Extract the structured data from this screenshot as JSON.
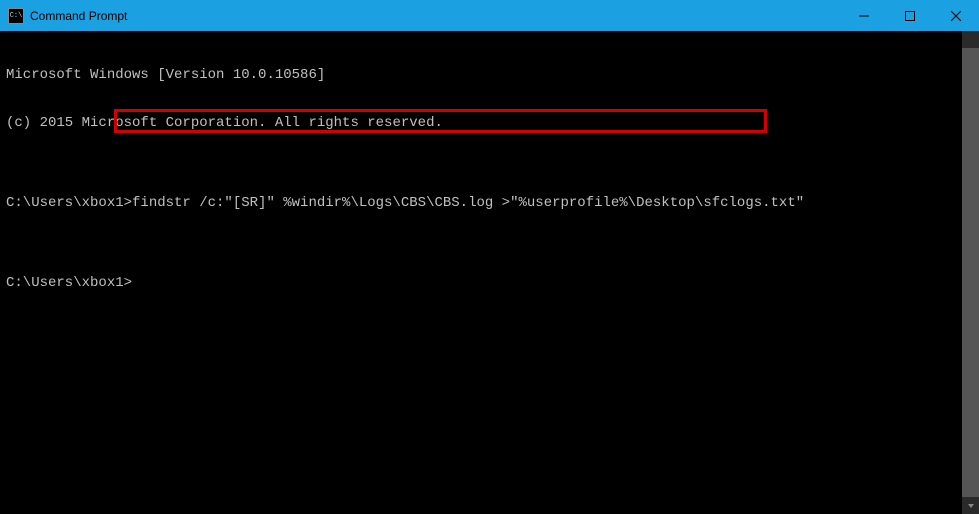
{
  "title_bar": {
    "icon_label": "C:\\",
    "title": "Command Prompt"
  },
  "terminal": {
    "lines": [
      "Microsoft Windows [Version 10.0.10586]",
      "(c) 2015 Microsoft Corporation. All rights reserved.",
      "",
      "C:\\Users\\xbox1>findstr /c:\"[SR]\" %windir%\\Logs\\CBS\\CBS.log >\"%userprofile%\\Desktop\\sfclogs.txt\"",
      "",
      "C:\\Users\\xbox1>"
    ]
  },
  "highlighted_command": "findstr /c:\"[SR]\" %windir%\\Logs\\CBS\\CBS.log >\"%userprofile%\\Desktop\\sfclogs.txt\""
}
